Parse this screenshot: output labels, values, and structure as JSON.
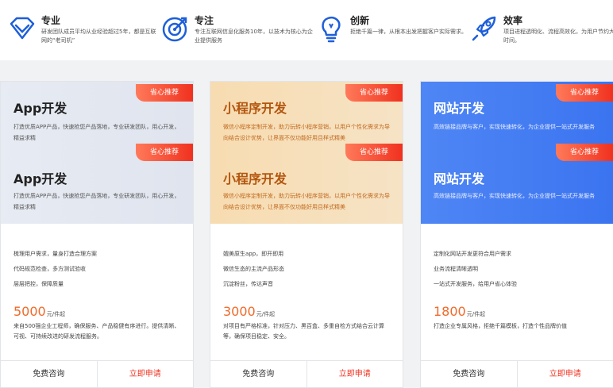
{
  "features": [
    {
      "icon": "diamond-icon",
      "title": "专业",
      "desc": "研发团队成员平均从业经验超过5年，都是互联网的“老司机”"
    },
    {
      "icon": "target-icon",
      "title": "专注",
      "desc": "专注互联网信息化服务10年，以技术为核心为企业提供服务"
    },
    {
      "icon": "lightbulb-icon",
      "title": "创新",
      "desc": "拒绝千篇一律，从根本出发把握客户实际需求。"
    },
    {
      "icon": "rocket-icon",
      "title": "效率",
      "desc": "项目进程透明化、流程高效化，为用户节约大量时间。"
    }
  ],
  "cards": [
    {
      "badge": "省心推荐",
      "title": "App开发",
      "desc": "打造优质APP产品，快速抢您产品落地，专业研发团队，用心开发，精益求精",
      "items": [
        "梳理用户需求，量身打造合理方案",
        "代码规范检查，多方测试验收",
        "层层把控，保障质量"
      ],
      "price": "5000",
      "unit": "元/件起",
      "price_desc": "来自500强企业工程师，确保服务、产品稳健有序进行。提供清晰、可视、可持续改进的研发流程服务。",
      "btn_free": "免费咨询",
      "btn_apply": "立即申请"
    },
    {
      "badge": "省心推荐",
      "title": "小程序开发",
      "desc": "微信小程序定制开发，助力玩转小程序营销，以用户个性化需求为导向结合设计优势，让界面不仅功能好用且样式精美",
      "items": [
        "媲美原生app，即开即用",
        "微信生态的主流产品形态",
        "沉淀粉丝，传达声音"
      ],
      "price": "3000",
      "unit": "元/件起",
      "price_desc": "对项目有严格标准，针对压力、黑百盒、多重自检方式结合云计算等，确保项目稳定、安全。",
      "btn_free": "免费咨询",
      "btn_apply": "立即申请"
    },
    {
      "badge": "省心推荐",
      "title": "网站开发",
      "desc": "高效链接品牌与客户，实现快速转化，为企业提供一站式开发服务",
      "items": [
        "定制化网站开发更符合用户需求",
        "业务流程清晰透明",
        "一站式开发服务，给用户省心体验"
      ],
      "price": "1800",
      "unit": "元/件起",
      "price_desc": "打造企业专属风格，拒绝千篇模板，打造个性品牌价值",
      "btn_free": "免费咨询",
      "btn_apply": "立即申请"
    }
  ],
  "colors": {
    "accent_red": "#f0311f",
    "price_orange": "#f06a2a",
    "blue_icon": "#1e5fd9"
  }
}
